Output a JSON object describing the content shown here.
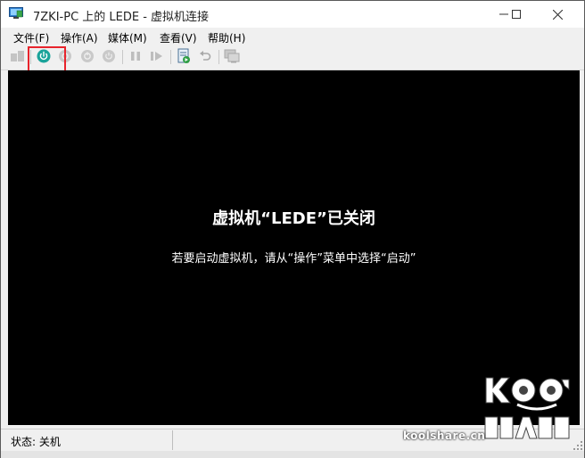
{
  "window": {
    "title": "7ZKI-PC 上的 LEDE - 虚拟机连接",
    "icon": "vm-connection-icon",
    "controls": [
      "minimize-icon",
      "maximize-icon",
      "close-icon"
    ]
  },
  "menu": {
    "items": [
      {
        "label": "文件(F)"
      },
      {
        "label": "操作(A)"
      },
      {
        "label": "媒体(M)"
      },
      {
        "label": "查看(V)"
      },
      {
        "label": "帮助(H)"
      }
    ]
  },
  "toolbar": {
    "buttons": [
      {
        "icon": "ctrl-alt-del-icon",
        "enabled": false
      },
      {
        "icon": "start-power-icon",
        "enabled": true,
        "color": "#1aa39a"
      },
      {
        "icon": "turn-off-icon",
        "enabled": false
      },
      {
        "icon": "shut-down-icon",
        "enabled": false
      },
      {
        "icon": "save-state-icon",
        "enabled": false
      },
      {
        "icon": "pause-icon",
        "enabled": false
      },
      {
        "icon": "resume-icon",
        "enabled": false
      },
      {
        "icon": "checkpoint-icon",
        "enabled": true
      },
      {
        "icon": "revert-icon",
        "enabled": false
      },
      {
        "icon": "enhanced-session-icon",
        "enabled": false
      }
    ],
    "highlight_color": "#e8242c"
  },
  "screen": {
    "heading": "虚拟机“LEDE”已关闭",
    "message": "若要启动虚拟机，请从“操作”菜单中选择“启动”",
    "background": "#000000"
  },
  "status": {
    "text": "状态: 关机"
  },
  "watermark": {
    "url": "koolshare.cn",
    "logo_text": "KOOLSHARE"
  }
}
